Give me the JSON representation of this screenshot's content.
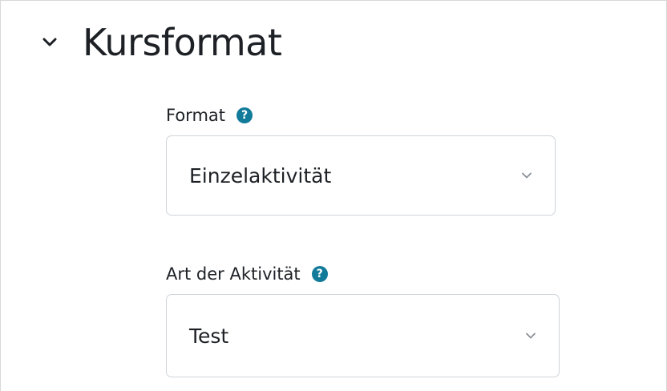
{
  "section": {
    "title": "Kursformat",
    "toggle_icon": "chevron-down-icon"
  },
  "fields": [
    {
      "label": "Format",
      "help_icon": "question-circle-icon",
      "help_glyph": "?",
      "value": "Einzelaktivität",
      "dropdown_icon": "chevron-down-icon"
    },
    {
      "label": "Art der Aktivität",
      "help_icon": "question-circle-icon",
      "help_glyph": "?",
      "value": "Test",
      "dropdown_icon": "chevron-down-icon"
    }
  ],
  "colors": {
    "help_icon": "#127b9a",
    "text": "#1d2125",
    "border": "#cfd4da"
  }
}
